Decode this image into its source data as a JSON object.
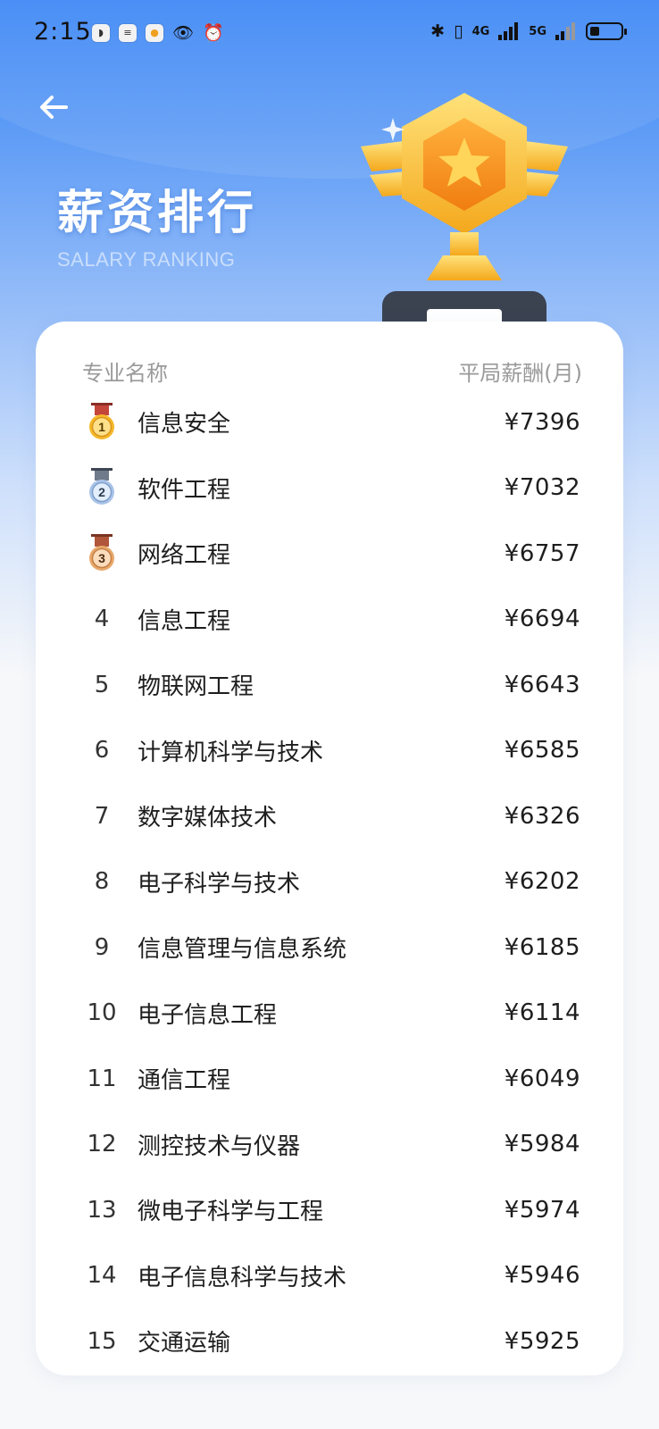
{
  "status_bar": {
    "time": "2:15",
    "network_4g": "4G",
    "network_5g": "5G"
  },
  "header": {
    "title": "薪资排行",
    "subtitle": "SALARY RANKING"
  },
  "table": {
    "col_major": "专业名称",
    "col_salary": "平局薪酬(月)",
    "rows": [
      {
        "rank": "1",
        "major": "信息安全",
        "salary": "¥7396",
        "medal": "gold"
      },
      {
        "rank": "2",
        "major": "软件工程",
        "salary": "¥7032",
        "medal": "silver"
      },
      {
        "rank": "3",
        "major": "网络工程",
        "salary": "¥6757",
        "medal": "bronze"
      },
      {
        "rank": "4",
        "major": "信息工程",
        "salary": "¥6694"
      },
      {
        "rank": "5",
        "major": "物联网工程",
        "salary": "¥6643"
      },
      {
        "rank": "6",
        "major": "计算机科学与技术",
        "salary": "¥6585"
      },
      {
        "rank": "7",
        "major": "数字媒体技术",
        "salary": "¥6326"
      },
      {
        "rank": "8",
        "major": "电子科学与技术",
        "salary": "¥6202"
      },
      {
        "rank": "9",
        "major": "信息管理与信息系统",
        "salary": "¥6185"
      },
      {
        "rank": "10",
        "major": "电子信息工程",
        "salary": "¥6114"
      },
      {
        "rank": "11",
        "major": "通信工程",
        "salary": "¥6049"
      },
      {
        "rank": "12",
        "major": "测控技术与仪器",
        "salary": "¥5984"
      },
      {
        "rank": "13",
        "major": "微电子科学与工程",
        "salary": "¥5974"
      },
      {
        "rank": "14",
        "major": "电子信息科学与技术",
        "salary": "¥5946"
      },
      {
        "rank": "15",
        "major": "交通运输",
        "salary": "¥5925"
      }
    ]
  },
  "icons": {
    "back": "back-arrow-icon",
    "trophy": "trophy-illustration",
    "medals": [
      "gold-medal-icon",
      "silver-medal-icon",
      "bronze-medal-icon"
    ]
  },
  "colors": {
    "header_blue": "#3c86f6",
    "gold": "#f5b82a",
    "silver": "#a9c4e8",
    "bronze": "#e8a86b",
    "ribbon_red": "#c4453a"
  }
}
